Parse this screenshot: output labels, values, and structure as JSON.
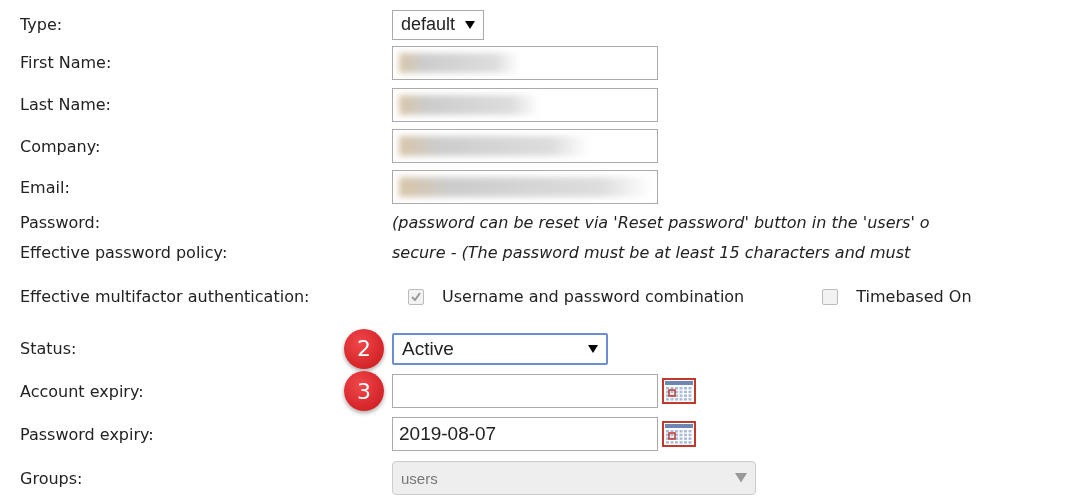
{
  "rows": [
    {
      "kind": "select",
      "label": "Type:",
      "value": "default"
    },
    {
      "kind": "blurred",
      "label": "First Name:"
    },
    {
      "kind": "blurred",
      "label": "Last Name:"
    },
    {
      "kind": "blurred",
      "label": "Company:"
    },
    {
      "kind": "blurred",
      "label": "Email:"
    },
    {
      "kind": "note",
      "label": "Password:",
      "text": "(password can be reset via 'Reset password' button in the 'users' o"
    },
    {
      "kind": "note",
      "label": "Effective password policy:",
      "text": "secure - (The password must be at least 15 characters and must"
    },
    {
      "kind": "checks",
      "label": "Effective multifactor authentication:",
      "options": [
        {
          "label": "Username and password combination",
          "checked": true,
          "disabled": true
        },
        {
          "label": "Timebased On",
          "checked": false,
          "disabled": true
        }
      ]
    },
    {
      "kind": "status",
      "label": "Status:",
      "value": "Active",
      "badge": "2"
    },
    {
      "kind": "date",
      "label": "Account expiry:",
      "value": "",
      "badge": "3"
    },
    {
      "kind": "date",
      "label": "Password expiry:",
      "value": "2019-08-07"
    },
    {
      "kind": "multiselect",
      "label": "Groups:",
      "value": "users",
      "disabled": true
    }
  ]
}
